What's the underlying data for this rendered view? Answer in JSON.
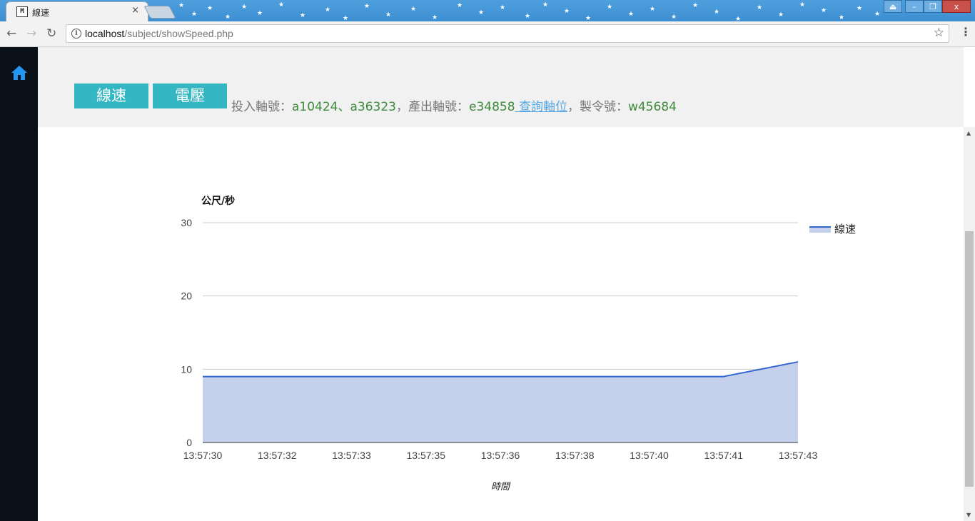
{
  "browser": {
    "tab_title": "線速",
    "tab_close": "×",
    "favicon_text": "M",
    "url_host": "localhost",
    "url_path": "/subject/showSpeed.php",
    "back_glyph": "←",
    "forward_glyph": "→",
    "reload_glyph": "↻",
    "star_glyph": "☆",
    "menu_glyph": "⋮",
    "info_glyph": "i",
    "window_buttons": [
      "⏏",
      "–",
      "❐",
      "x"
    ]
  },
  "sidebar": {
    "home_icon": "home-icon",
    "accent": "#2196f3"
  },
  "header": {
    "buttons": [
      {
        "label": "線速"
      },
      {
        "label": "電壓"
      }
    ],
    "info": {
      "input_label": "投入軸號：",
      "input_value": "a10424、a36323",
      "sep1": "，",
      "output_label": "產出軸號：",
      "output_value": "e34858",
      "lookup_link": " 查詢軸位",
      "sep2": "，",
      "order_label": "製令號：",
      "order_value": "w45684"
    }
  },
  "chart_data": {
    "type": "area",
    "ylabel": "公尺/秒",
    "xlabel": "時間",
    "x": [
      "13:57:30",
      "13:57:32",
      "13:57:33",
      "13:57:35",
      "13:57:36",
      "13:57:38",
      "13:57:40",
      "13:57:41",
      "13:57:43"
    ],
    "series": [
      {
        "name": "線速",
        "values": [
          9,
          9,
          9,
          9,
          9,
          9,
          9,
          9,
          11
        ],
        "line_color": "#3366cc",
        "fill_color": "#c5d0ec"
      }
    ],
    "yticks": [
      0,
      10,
      20,
      30
    ],
    "ylim": [
      0,
      30
    ],
    "grid": true,
    "legend": "right"
  },
  "colors": {
    "button_bg": "#35b6c3",
    "value_text": "#3c8a3a",
    "link_text": "#55a7e6",
    "titlebar": "#4d9fdc"
  }
}
